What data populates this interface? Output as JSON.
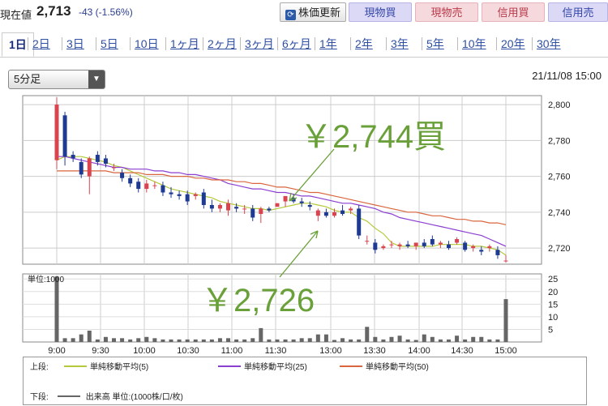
{
  "header": {
    "price_label": "現在値",
    "price": "2,713",
    "change": "-43 (-1.56%)",
    "refresh_label": "株価更新",
    "buttons": [
      {
        "label": "現物買",
        "kind": "buy"
      },
      {
        "label": "現物売",
        "kind": "sell"
      },
      {
        "label": "信用買",
        "kind": "sell"
      },
      {
        "label": "信用売",
        "kind": "buy"
      }
    ]
  },
  "tabs": [
    "1日",
    "2日",
    "3日",
    "5日",
    "10日",
    "1ヶ月",
    "2ヶ月",
    "3ヶ月",
    "6ヶ月",
    "1年",
    "2年",
    "3年",
    "5年",
    "10年",
    "20年",
    "30年"
  ],
  "active_tab": 0,
  "interval_select": "5分足",
  "datetime": "21/11/08 15:00",
  "colors": {
    "up": "#d9444f",
    "down": "#1f3a93",
    "ma5": "#b5c93a",
    "ma25": "#8a3fd1",
    "ma50": "#d9663e",
    "annotation": "#6aa039",
    "volume": "#666666"
  },
  "chart_data": [
    {
      "type": "candlestick",
      "x_labels": [
        "9:00",
        "9:30",
        "10:00",
        "10:30",
        "11:00",
        "11:30",
        "13:00",
        "13:30",
        "14:00",
        "14:30",
        "15:00"
      ],
      "y_ticks": [
        2720,
        2740,
        2760,
        2780,
        2800
      ],
      "ylim": [
        2711,
        2805
      ],
      "candles": [
        {
          "o": 2769,
          "h": 2804,
          "l": 2764,
          "c": 2800
        },
        {
          "o": 2794,
          "h": 2796,
          "l": 2766,
          "c": 2771
        },
        {
          "o": 2772,
          "h": 2774,
          "l": 2768,
          "c": 2770
        },
        {
          "o": 2768,
          "h": 2770,
          "l": 2759,
          "c": 2761
        },
        {
          "o": 2760,
          "h": 2771,
          "l": 2750,
          "c": 2770
        },
        {
          "o": 2772,
          "h": 2774,
          "l": 2766,
          "c": 2768
        },
        {
          "o": 2770,
          "h": 2772,
          "l": 2765,
          "c": 2767
        },
        {
          "o": 2765,
          "h": 2767,
          "l": 2763,
          "c": 2765
        },
        {
          "o": 2762,
          "h": 2764,
          "l": 2757,
          "c": 2759
        },
        {
          "o": 2759,
          "h": 2761,
          "l": 2754,
          "c": 2756
        },
        {
          "o": 2757,
          "h": 2759,
          "l": 2751,
          "c": 2753
        },
        {
          "o": 2753,
          "h": 2758,
          "l": 2751,
          "c": 2756
        },
        {
          "o": 2755,
          "h": 2757,
          "l": 2753,
          "c": 2755
        },
        {
          "o": 2755,
          "h": 2757,
          "l": 2749,
          "c": 2751
        },
        {
          "o": 2751,
          "h": 2754,
          "l": 2748,
          "c": 2750
        },
        {
          "o": 2750,
          "h": 2752,
          "l": 2747,
          "c": 2749
        },
        {
          "o": 2750,
          "h": 2752,
          "l": 2744,
          "c": 2746
        },
        {
          "o": 2749,
          "h": 2751,
          "l": 2747,
          "c": 2750
        },
        {
          "o": 2751,
          "h": 2753,
          "l": 2742,
          "c": 2744
        },
        {
          "o": 2744,
          "h": 2747,
          "l": 2740,
          "c": 2742
        },
        {
          "o": 2742,
          "h": 2745,
          "l": 2740,
          "c": 2744
        },
        {
          "o": 2741,
          "h": 2747,
          "l": 2738,
          "c": 2745
        },
        {
          "o": 2743,
          "h": 2745,
          "l": 2740,
          "c": 2742
        },
        {
          "o": 2742,
          "h": 2744,
          "l": 2739,
          "c": 2742
        },
        {
          "o": 2742,
          "h": 2744,
          "l": 2735,
          "c": 2737
        },
        {
          "o": 2739,
          "h": 2743,
          "l": 2734,
          "c": 2742
        },
        {
          "o": 2742,
          "h": 2743,
          "l": 2740,
          "c": 2741
        },
        {
          "o": 2743,
          "h": 2745,
          "l": 2744,
          "c": 2745
        },
        {
          "o": 2746,
          "h": 2748,
          "l": 2743,
          "c": 2749
        },
        {
          "o": 2748,
          "h": 2750,
          "l": 2745,
          "c": 2746
        },
        {
          "o": 2746,
          "h": 2748,
          "l": 2743,
          "c": 2745
        },
        {
          "o": 2744,
          "h": 2746,
          "l": 2741,
          "c": 2743
        },
        {
          "o": 2738,
          "h": 2742,
          "l": 2735,
          "c": 2741
        },
        {
          "o": 2740,
          "h": 2742,
          "l": 2737,
          "c": 2738
        },
        {
          "o": 2738,
          "h": 2742,
          "l": 2737,
          "c": 2740
        },
        {
          "o": 2741,
          "h": 2744,
          "l": 2738,
          "c": 2739
        },
        {
          "o": 2741,
          "h": 2743,
          "l": 2739,
          "c": 2742
        },
        {
          "o": 2742,
          "h": 2744,
          "l": 2725,
          "c": 2727
        },
        {
          "o": 2724,
          "h": 2727,
          "l": 2722,
          "c": 2724
        },
        {
          "o": 2723,
          "h": 2725,
          "l": 2717,
          "c": 2719
        },
        {
          "o": 2720,
          "h": 2722,
          "l": 2719,
          "c": 2721
        },
        {
          "o": 2722,
          "h": 2724,
          "l": 2720,
          "c": 2722
        },
        {
          "o": 2721,
          "h": 2723,
          "l": 2719,
          "c": 2722
        },
        {
          "o": 2722,
          "h": 2724,
          "l": 2720,
          "c": 2721
        },
        {
          "o": 2721,
          "h": 2723,
          "l": 2719,
          "c": 2723
        },
        {
          "o": 2723,
          "h": 2725,
          "l": 2720,
          "c": 2721
        },
        {
          "o": 2725,
          "h": 2727,
          "l": 2721,
          "c": 2722
        },
        {
          "o": 2722,
          "h": 2724,
          "l": 2720,
          "c": 2723
        },
        {
          "o": 2722,
          "h": 2724,
          "l": 2719,
          "c": 2720
        },
        {
          "o": 2723,
          "h": 2726,
          "l": 2722,
          "c": 2725
        },
        {
          "o": 2723,
          "h": 2724,
          "l": 2718,
          "c": 2719
        },
        {
          "o": 2720,
          "h": 2722,
          "l": 2718,
          "c": 2721
        },
        {
          "o": 2719,
          "h": 2721,
          "l": 2716,
          "c": 2718
        },
        {
          "o": 2720,
          "h": 2722,
          "l": 2718,
          "c": 2721
        },
        {
          "o": 2719,
          "h": 2721,
          "l": 2714,
          "c": 2716
        },
        {
          "o": 2713,
          "h": 2716,
          "l": 2712,
          "c": 2713
        }
      ],
      "series": [
        {
          "name": "単純移動平均(5)",
          "values": [
            2769,
            2771,
            2771,
            2771,
            2770,
            2769,
            2768,
            2766,
            2765,
            2763,
            2761,
            2759,
            2757,
            2755,
            2753,
            2752,
            2751,
            2750,
            2749,
            2748,
            2746,
            2745,
            2744,
            2743,
            2742,
            2742,
            2741,
            2742,
            2743,
            2744,
            2745,
            2745,
            2744,
            2743,
            2741,
            2740,
            2740,
            2737,
            2735,
            2731,
            2728,
            2723,
            2721,
            2721,
            2721,
            2721,
            2721,
            2722,
            2722,
            2722,
            2722,
            2721,
            2721,
            2720,
            2719,
            2716
          ]
        },
        {
          "name": "単純移動平均(25)",
          "values": [
            2771,
            2771,
            2770,
            2769,
            2768,
            2767,
            2766,
            2765,
            2765,
            2764,
            2764,
            2764,
            2763,
            2763,
            2762,
            2762,
            2761,
            2761,
            2760,
            2759,
            2758,
            2756,
            2755,
            2754,
            2753,
            2753,
            2752,
            2751,
            2751,
            2750,
            2749,
            2749,
            2748,
            2747,
            2746,
            2745,
            2745,
            2744,
            2743,
            2742,
            2740,
            2739,
            2737,
            2736,
            2735,
            2734,
            2733,
            2732,
            2731,
            2730,
            2729,
            2728,
            2727,
            2725,
            2723,
            2721
          ]
        },
        {
          "name": "単純移動平均(50)",
          "values": [
            2763,
            2763,
            2763,
            2763,
            2763,
            2763,
            2763,
            2762,
            2762,
            2762,
            2762,
            2761,
            2761,
            2761,
            2760,
            2760,
            2760,
            2759,
            2759,
            2758,
            2758,
            2758,
            2757,
            2757,
            2756,
            2756,
            2755,
            2754,
            2754,
            2753,
            2752,
            2751,
            2751,
            2750,
            2749,
            2748,
            2747,
            2746,
            2745,
            2744,
            2743,
            2742,
            2741,
            2740,
            2740,
            2739,
            2738,
            2738,
            2737,
            2736,
            2736,
            2735,
            2735,
            2734,
            2734,
            2733
          ]
        }
      ],
      "annotations": [
        "￥2,744買",
        "￥2,726"
      ]
    },
    {
      "type": "bar",
      "title": "単位:1000",
      "y_ticks": [
        5,
        10,
        15,
        20,
        25
      ],
      "ylim": [
        0,
        27
      ],
      "values": [
        26,
        1.5,
        1.5,
        3,
        4.5,
        1,
        2,
        1.5,
        1.5,
        1,
        1.5,
        2,
        1.5,
        1,
        1,
        1,
        1,
        1,
        1,
        1,
        1.5,
        1.5,
        1,
        1,
        1.5,
        5.5,
        1,
        1,
        1,
        1,
        1.5,
        1.5,
        3,
        3,
        0.8,
        1.5,
        1,
        1,
        6,
        2,
        1,
        2,
        2.5,
        1,
        0.8,
        3,
        2,
        1,
        1,
        2.5,
        1,
        2,
        2,
        1,
        1,
        17
      ]
    }
  ],
  "legend": {
    "upper_label": "上段:",
    "lower_label": "下段:",
    "volume_label": "出来高 単位:(1000株/口/枚)"
  }
}
